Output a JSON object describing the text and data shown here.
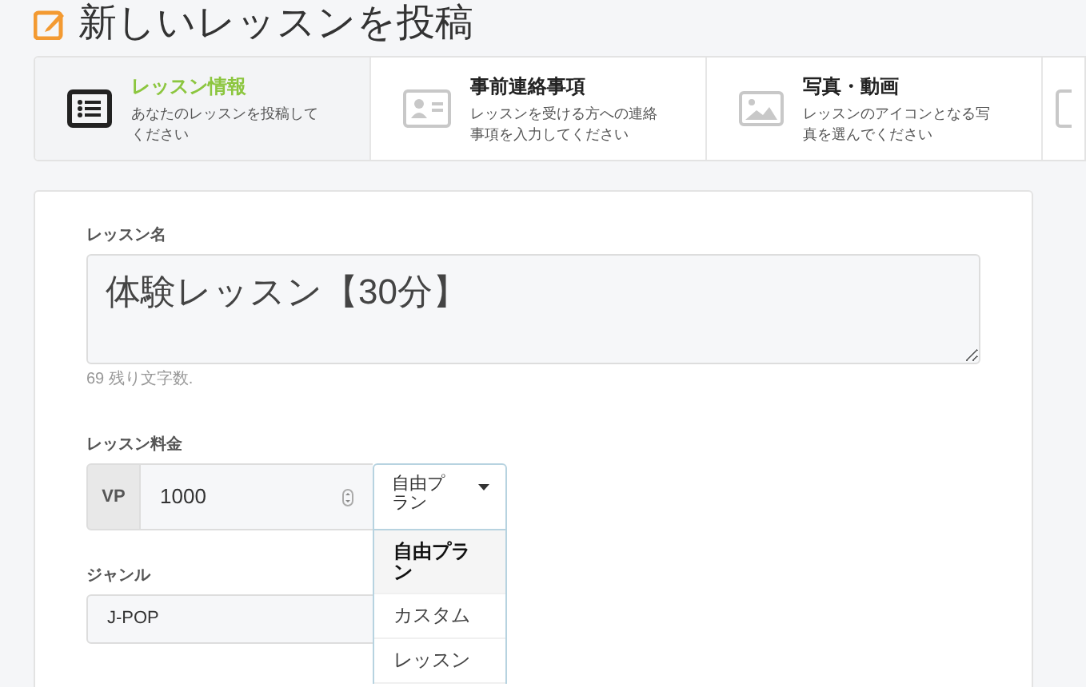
{
  "page_title": "新しいレッスンを投稿",
  "steps": [
    {
      "kind": "list",
      "title": "レッスン情報",
      "description": "あなたのレッスンを投稿してください",
      "selected": true
    },
    {
      "kind": "contact",
      "title": "事前連絡事項",
      "description": "レッスンを受ける方への連絡事項を入力してください",
      "selected": false
    },
    {
      "kind": "image",
      "title": "写真・動画",
      "description": "レッスンのアイコンとなる写真を選んでください",
      "selected": false
    },
    {
      "kind": "blank",
      "selected": false
    }
  ],
  "lesson_name": {
    "label": "レッスン名",
    "value": "体験レッスン【30分】",
    "counter": "69 残り文字数."
  },
  "price": {
    "label": "レッスン料金",
    "currency": "VP",
    "value": "1000",
    "plan": "自由プラン",
    "options": [
      {
        "label": "自由プラン",
        "selected": true
      },
      {
        "label": "カスタム",
        "selected": false
      },
      {
        "label": "レッスン",
        "selected": false
      }
    ]
  },
  "genre": {
    "label": "ジャンル",
    "value": "J-POP"
  }
}
